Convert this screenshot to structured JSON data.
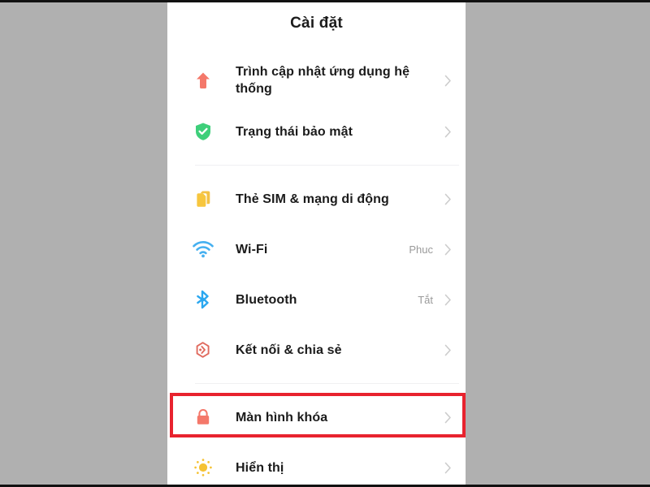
{
  "colors": {
    "page_background": "#b0b0b0",
    "screen_background": "#ffffff",
    "title_text": "#1b1b1b",
    "label_text": "#1b1b1b",
    "value_text": "#9a9a9a",
    "chevron": "#cccccc",
    "divider": "#f0f0f2",
    "highlight_border": "#e8232e",
    "icon_coral": "#f4786a",
    "icon_green": "#3ecf7a",
    "icon_yellow": "#f7c63e",
    "icon_blue": "#45b0f0",
    "icon_sun": "#f5c234"
  },
  "header": {
    "title": "Cài đặt"
  },
  "groups": [
    {
      "rows": [
        {
          "icon": "update-arrow-icon",
          "label": "Trình cập nhật ứng dụng hệ thống",
          "value": "",
          "chevron": true,
          "highlighted": false
        },
        {
          "icon": "security-shield-icon",
          "label": "Trạng thái bảo mật",
          "value": "",
          "chevron": true,
          "highlighted": false
        }
      ]
    },
    {
      "rows": [
        {
          "icon": "sim-card-icon",
          "label": "Thẻ SIM & mạng di động",
          "value": "",
          "chevron": true,
          "highlighted": false
        },
        {
          "icon": "wifi-icon",
          "label": "Wi-Fi",
          "value": "Phuc",
          "chevron": true,
          "highlighted": false
        },
        {
          "icon": "bluetooth-icon",
          "label": "Bluetooth",
          "value": "Tắt",
          "chevron": true,
          "highlighted": false
        },
        {
          "icon": "connection-sharing-icon",
          "label": "Kết nối & chia sẻ",
          "value": "",
          "chevron": true,
          "highlighted": false
        }
      ]
    },
    {
      "rows": [
        {
          "icon": "lock-screen-icon",
          "label": "Màn hình khóa",
          "value": "",
          "chevron": true,
          "highlighted": true
        },
        {
          "icon": "display-brightness-icon",
          "label": "Hiển thị",
          "value": "",
          "chevron": true,
          "highlighted": false
        }
      ]
    }
  ]
}
